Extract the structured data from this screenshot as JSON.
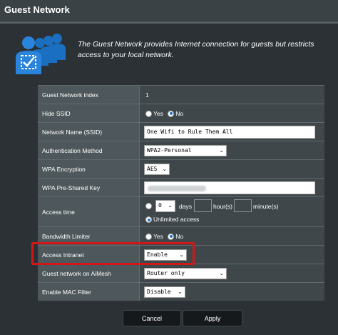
{
  "header": {
    "title": "Guest Network"
  },
  "description": "The Guest Network provides Internet connection for guests but restricts access to your local network.",
  "form": {
    "index": {
      "label": "Guest Network index",
      "value": "1"
    },
    "hide_ssid": {
      "label": "Hide SSID",
      "yes": "Yes",
      "no": "No",
      "selected": "No"
    },
    "ssid": {
      "label": "Network Name (SSID)",
      "value": "One Wifi to Rule Them All"
    },
    "auth": {
      "label": "Authentication Method",
      "value": "WPA2-Personal"
    },
    "encryption": {
      "label": "WPA Encryption",
      "value": "AES"
    },
    "psk": {
      "label": "WPA Pre-Shared Key"
    },
    "access_time": {
      "label": "Access time",
      "days_value": "0",
      "days": "days",
      "hours": "hour(s)",
      "minutes": "minute(s)",
      "unlimited": "Unlimited access"
    },
    "bandwidth": {
      "label": "Bandwidth Limiter",
      "yes": "Yes",
      "no": "No",
      "selected": "No"
    },
    "intranet": {
      "label": "Access Intranet",
      "value": "Enable"
    },
    "aimesh": {
      "label": "Guest network on AiMesh",
      "value": "Router only"
    },
    "mac_filter": {
      "label": "Enable MAC Filter",
      "value": "Disable"
    }
  },
  "buttons": {
    "cancel": "Cancel",
    "apply": "Apply"
  },
  "colors": {
    "highlight": "#d01818",
    "accent": "#1e73c8",
    "icon": "#1a6fc1"
  }
}
